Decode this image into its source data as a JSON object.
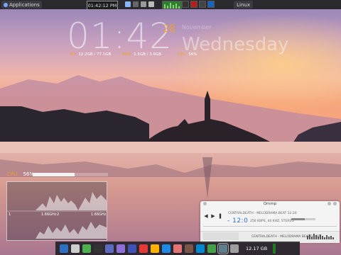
{
  "top_panel": {
    "apps_label": "Applications",
    "clock": "01:42:12 PM",
    "os_label": "Linux"
  },
  "conky": {
    "time": "01:42",
    "day": "28",
    "month": "November",
    "weekday": "Wednesday",
    "hdd_label": "HD",
    "hdd_value": "12.2GB / 77.1GB",
    "ram_label": "RAM",
    "ram_value": "1.5GB / 3.9GB",
    "cpu_label": "CPU",
    "cpu_value": "56%"
  },
  "cpu_widget": {
    "label": "CPU",
    "percent": "56%",
    "usage": 0.56,
    "freq1": "1.66GHz",
    "freq2": "1.66GHz",
    "core1": "1",
    "core2": "2"
  },
  "player": {
    "title": "Qmmp",
    "track": "CENTRALDEATH - MELODRAMA BEAT  12:20",
    "time": "- 12:0",
    "info": "256 KBPS, 44 KHZ, STEREO",
    "bottom_track": "CENTRALDEATH - MELODRAMA BEAT  12:20",
    "volume": 0.55
  },
  "dock": {
    "disk_label": "12.17 GB",
    "icons": [
      "files-icon",
      "settings-icon",
      "trash-icon",
      "terminal-icon",
      "system-icon",
      "user-icon",
      "web-icon",
      "chrome-icon",
      "paint-icon",
      "photos-icon",
      "media-icon",
      "tools-icon",
      "vscode-icon",
      "chart-icon",
      "player-icon",
      "camera-icon"
    ],
    "colors": [
      "#2f6fbf",
      "#ccc",
      "#4caf50",
      "#333",
      "#5c6bc0",
      "#8e6fd8",
      "#3f51b5",
      "#e53935",
      "#ffb300",
      "#1e88e5",
      "#e57373",
      "#795548",
      "#0288d1",
      "#43a047",
      "#607d8b",
      "#9e9e9e"
    ]
  }
}
